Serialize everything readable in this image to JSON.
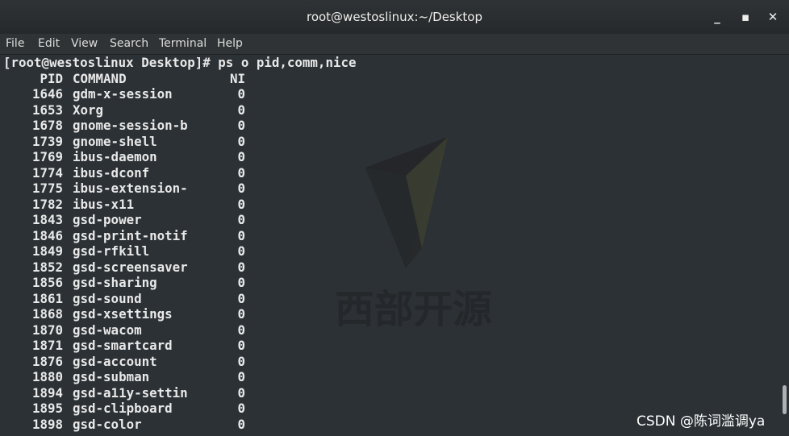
{
  "window": {
    "title": "root@westoslinux:~/Desktop"
  },
  "window_controls": {
    "minimize": "_",
    "maximize": "▪",
    "close": "✕"
  },
  "menu": [
    "File",
    "Edit",
    "View",
    "Search",
    "Terminal",
    "Help"
  ],
  "terminal": {
    "prompt": "[root@westoslinux Desktop]# ps o pid,comm,nice",
    "headers": {
      "pid": "PID",
      "command": "COMMAND",
      "ni": "NI"
    },
    "rows": [
      {
        "pid": "1646",
        "command": "gdm-x-session",
        "ni": "0"
      },
      {
        "pid": "1653",
        "command": "Xorg",
        "ni": "0"
      },
      {
        "pid": "1678",
        "command": "gnome-session-b",
        "ni": "0"
      },
      {
        "pid": "1739",
        "command": "gnome-shell",
        "ni": "0"
      },
      {
        "pid": "1769",
        "command": "ibus-daemon",
        "ni": "0"
      },
      {
        "pid": "1774",
        "command": "ibus-dconf",
        "ni": "0"
      },
      {
        "pid": "1775",
        "command": "ibus-extension-",
        "ni": "0"
      },
      {
        "pid": "1782",
        "command": "ibus-x11",
        "ni": "0"
      },
      {
        "pid": "1843",
        "command": "gsd-power",
        "ni": "0"
      },
      {
        "pid": "1846",
        "command": "gsd-print-notif",
        "ni": "0"
      },
      {
        "pid": "1849",
        "command": "gsd-rfkill",
        "ni": "0"
      },
      {
        "pid": "1852",
        "command": "gsd-screensaver",
        "ni": "0"
      },
      {
        "pid": "1856",
        "command": "gsd-sharing",
        "ni": "0"
      },
      {
        "pid": "1861",
        "command": "gsd-sound",
        "ni": "0"
      },
      {
        "pid": "1868",
        "command": "gsd-xsettings",
        "ni": "0"
      },
      {
        "pid": "1870",
        "command": "gsd-wacom",
        "ni": "0"
      },
      {
        "pid": "1871",
        "command": "gsd-smartcard",
        "ni": "0"
      },
      {
        "pid": "1876",
        "command": "gsd-account",
        "ni": "0"
      },
      {
        "pid": "1880",
        "command": "gsd-subman",
        "ni": "0"
      },
      {
        "pid": "1894",
        "command": "gsd-a11y-settin",
        "ni": "0"
      },
      {
        "pid": "1895",
        "command": "gsd-clipboard",
        "ni": "0"
      },
      {
        "pid": "1898",
        "command": "gsd-color",
        "ni": "0"
      }
    ]
  },
  "watermark": {
    "text": "西部开源"
  },
  "csdn_watermark": "CSDN @陈词滥调ya",
  "colors": {
    "terminal_bg": "#2c3135",
    "text": "#e9e9e9",
    "titlebar": "#2f3335"
  }
}
